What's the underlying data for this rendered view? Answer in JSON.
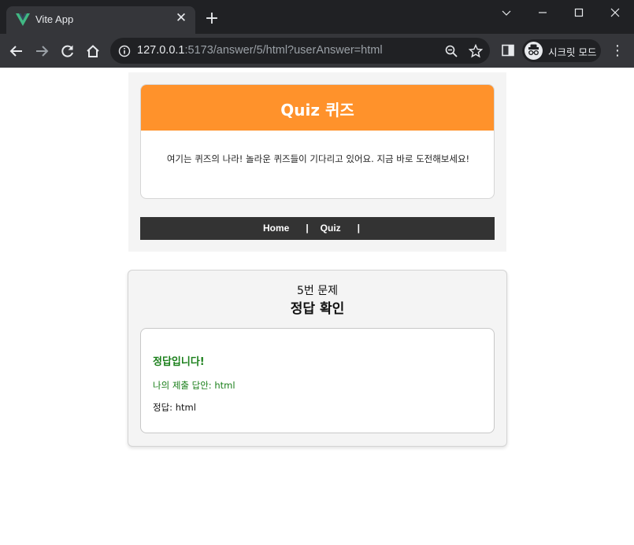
{
  "browser": {
    "tab_title": "Vite App",
    "url_host": "127.0.0.1",
    "url_rest": ":5173/answer/5/html?userAnswer=html",
    "incognito_label": "시크릿 모드"
  },
  "quiz_header": {
    "title": "Quiz 퀴즈",
    "description": "여기는 퀴즈의 나라! 놀라운 퀴즈들이 기다리고 있어요. 지금 바로 도전해보세요!"
  },
  "nav": {
    "items": [
      {
        "label": "Home"
      },
      {
        "label": "Quiz"
      }
    ],
    "separator": "|"
  },
  "answer": {
    "question_number": "5번 문제",
    "heading": "정답 확인",
    "status": "정답입니다!",
    "user_answer": "나의 제출 답안: html",
    "correct_answer": "정답: html"
  },
  "colors": {
    "header_orange": "#ff922b",
    "navbar": "#333333",
    "correct_green": "#1a7f1a"
  },
  "icons": [
    "vue-logo-icon",
    "close-icon",
    "plus-icon",
    "chevron-down-icon",
    "minimize-icon",
    "maximize-icon",
    "window-close-icon",
    "back-arrow-icon",
    "forward-arrow-icon",
    "reload-icon",
    "home-icon",
    "info-icon",
    "zoom-icon",
    "star-icon",
    "side-panel-icon",
    "incognito-icon",
    "kebab-menu-icon"
  ]
}
